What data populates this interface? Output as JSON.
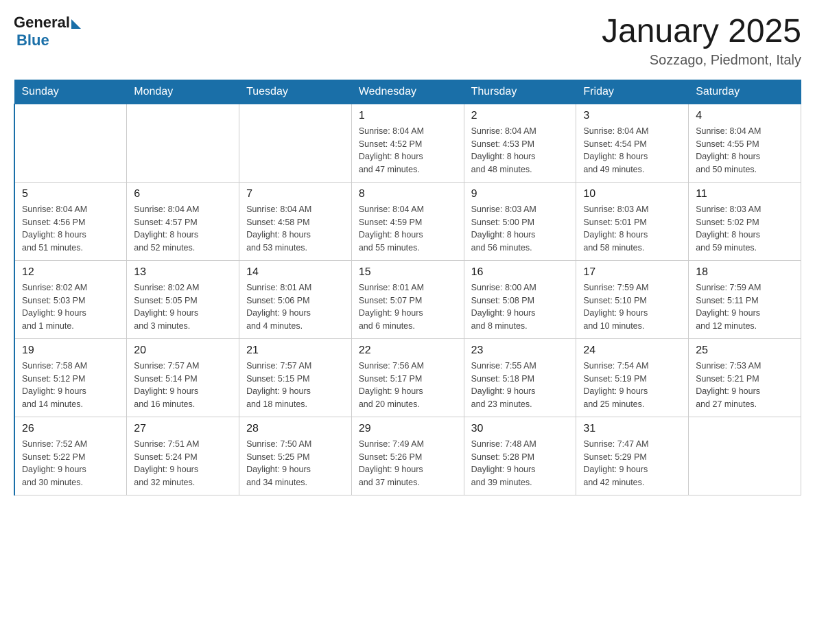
{
  "header": {
    "logo_general": "General",
    "logo_blue": "Blue",
    "month_title": "January 2025",
    "location": "Sozzago, Piedmont, Italy"
  },
  "weekdays": [
    "Sunday",
    "Monday",
    "Tuesday",
    "Wednesday",
    "Thursday",
    "Friday",
    "Saturday"
  ],
  "weeks": [
    [
      {
        "day": "",
        "info": ""
      },
      {
        "day": "",
        "info": ""
      },
      {
        "day": "",
        "info": ""
      },
      {
        "day": "1",
        "info": "Sunrise: 8:04 AM\nSunset: 4:52 PM\nDaylight: 8 hours\nand 47 minutes."
      },
      {
        "day": "2",
        "info": "Sunrise: 8:04 AM\nSunset: 4:53 PM\nDaylight: 8 hours\nand 48 minutes."
      },
      {
        "day": "3",
        "info": "Sunrise: 8:04 AM\nSunset: 4:54 PM\nDaylight: 8 hours\nand 49 minutes."
      },
      {
        "day": "4",
        "info": "Sunrise: 8:04 AM\nSunset: 4:55 PM\nDaylight: 8 hours\nand 50 minutes."
      }
    ],
    [
      {
        "day": "5",
        "info": "Sunrise: 8:04 AM\nSunset: 4:56 PM\nDaylight: 8 hours\nand 51 minutes."
      },
      {
        "day": "6",
        "info": "Sunrise: 8:04 AM\nSunset: 4:57 PM\nDaylight: 8 hours\nand 52 minutes."
      },
      {
        "day": "7",
        "info": "Sunrise: 8:04 AM\nSunset: 4:58 PM\nDaylight: 8 hours\nand 53 minutes."
      },
      {
        "day": "8",
        "info": "Sunrise: 8:04 AM\nSunset: 4:59 PM\nDaylight: 8 hours\nand 55 minutes."
      },
      {
        "day": "9",
        "info": "Sunrise: 8:03 AM\nSunset: 5:00 PM\nDaylight: 8 hours\nand 56 minutes."
      },
      {
        "day": "10",
        "info": "Sunrise: 8:03 AM\nSunset: 5:01 PM\nDaylight: 8 hours\nand 58 minutes."
      },
      {
        "day": "11",
        "info": "Sunrise: 8:03 AM\nSunset: 5:02 PM\nDaylight: 8 hours\nand 59 minutes."
      }
    ],
    [
      {
        "day": "12",
        "info": "Sunrise: 8:02 AM\nSunset: 5:03 PM\nDaylight: 9 hours\nand 1 minute."
      },
      {
        "day": "13",
        "info": "Sunrise: 8:02 AM\nSunset: 5:05 PM\nDaylight: 9 hours\nand 3 minutes."
      },
      {
        "day": "14",
        "info": "Sunrise: 8:01 AM\nSunset: 5:06 PM\nDaylight: 9 hours\nand 4 minutes."
      },
      {
        "day": "15",
        "info": "Sunrise: 8:01 AM\nSunset: 5:07 PM\nDaylight: 9 hours\nand 6 minutes."
      },
      {
        "day": "16",
        "info": "Sunrise: 8:00 AM\nSunset: 5:08 PM\nDaylight: 9 hours\nand 8 minutes."
      },
      {
        "day": "17",
        "info": "Sunrise: 7:59 AM\nSunset: 5:10 PM\nDaylight: 9 hours\nand 10 minutes."
      },
      {
        "day": "18",
        "info": "Sunrise: 7:59 AM\nSunset: 5:11 PM\nDaylight: 9 hours\nand 12 minutes."
      }
    ],
    [
      {
        "day": "19",
        "info": "Sunrise: 7:58 AM\nSunset: 5:12 PM\nDaylight: 9 hours\nand 14 minutes."
      },
      {
        "day": "20",
        "info": "Sunrise: 7:57 AM\nSunset: 5:14 PM\nDaylight: 9 hours\nand 16 minutes."
      },
      {
        "day": "21",
        "info": "Sunrise: 7:57 AM\nSunset: 5:15 PM\nDaylight: 9 hours\nand 18 minutes."
      },
      {
        "day": "22",
        "info": "Sunrise: 7:56 AM\nSunset: 5:17 PM\nDaylight: 9 hours\nand 20 minutes."
      },
      {
        "day": "23",
        "info": "Sunrise: 7:55 AM\nSunset: 5:18 PM\nDaylight: 9 hours\nand 23 minutes."
      },
      {
        "day": "24",
        "info": "Sunrise: 7:54 AM\nSunset: 5:19 PM\nDaylight: 9 hours\nand 25 minutes."
      },
      {
        "day": "25",
        "info": "Sunrise: 7:53 AM\nSunset: 5:21 PM\nDaylight: 9 hours\nand 27 minutes."
      }
    ],
    [
      {
        "day": "26",
        "info": "Sunrise: 7:52 AM\nSunset: 5:22 PM\nDaylight: 9 hours\nand 30 minutes."
      },
      {
        "day": "27",
        "info": "Sunrise: 7:51 AM\nSunset: 5:24 PM\nDaylight: 9 hours\nand 32 minutes."
      },
      {
        "day": "28",
        "info": "Sunrise: 7:50 AM\nSunset: 5:25 PM\nDaylight: 9 hours\nand 34 minutes."
      },
      {
        "day": "29",
        "info": "Sunrise: 7:49 AM\nSunset: 5:26 PM\nDaylight: 9 hours\nand 37 minutes."
      },
      {
        "day": "30",
        "info": "Sunrise: 7:48 AM\nSunset: 5:28 PM\nDaylight: 9 hours\nand 39 minutes."
      },
      {
        "day": "31",
        "info": "Sunrise: 7:47 AM\nSunset: 5:29 PM\nDaylight: 9 hours\nand 42 minutes."
      },
      {
        "day": "",
        "info": ""
      }
    ]
  ]
}
